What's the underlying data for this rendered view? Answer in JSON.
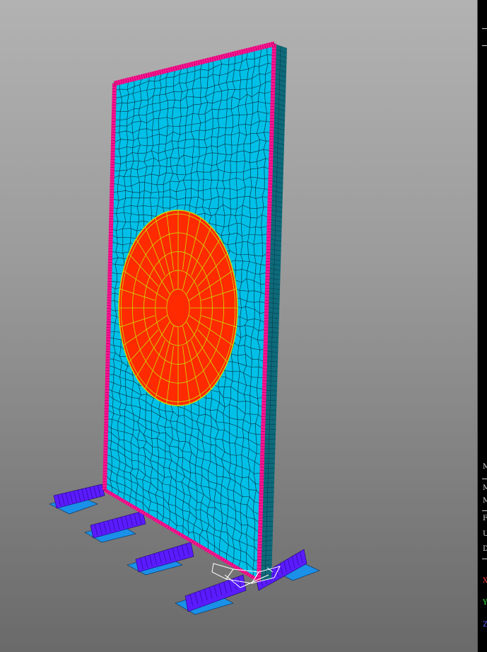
{
  "window": {
    "background_top": "#b2b2b2",
    "background_bottom": "#6a6a6a"
  },
  "model": {
    "panel_color": "#00c0e8",
    "mesh_line_color": "#0a2a3a",
    "circle_fill_color": "#ff2a00",
    "circle_mesh_color": "#c8e000",
    "frame_color": "#ff1493",
    "support_color": "#5a1cff",
    "base_plate_color": "#1a90e8",
    "triad_color": "#ffffff"
  },
  "side_panel": {
    "labels": [
      {
        "id": "m1",
        "text": "M"
      },
      {
        "id": "m2",
        "text": "M"
      },
      {
        "id": "m3",
        "text": "M"
      },
      {
        "id": "f1",
        "text": "F"
      },
      {
        "id": "u1",
        "text": "U"
      },
      {
        "id": "d1",
        "text": "D"
      },
      {
        "id": "axis-x",
        "text": "X",
        "color": "#ff4040"
      },
      {
        "id": "axis-y",
        "text": "Y",
        "color": "#40ff40"
      },
      {
        "id": "axis-z",
        "text": "Z",
        "color": "#6060ff"
      }
    ]
  }
}
